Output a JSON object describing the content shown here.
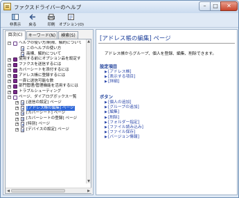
{
  "window": {
    "title": "ファクスドライバーのヘルプ",
    "minimize": "–",
    "maximize": "□",
    "close": "✕"
  },
  "toolbar": [
    {
      "icon": "hide-pane-icon",
      "label": "非表示"
    },
    {
      "icon": "back-arrow-icon",
      "label": "戻る"
    },
    {
      "icon": "printer-icon",
      "label": "印刷"
    },
    {
      "icon": "options-icon",
      "label": "オプション(O)"
    }
  ],
  "tabs": [
    "目次(C)",
    "キーワード(N)",
    "検索(S)"
  ],
  "tree": [
    {
      "level": 0,
      "type": "book-open",
      "expander": "−",
      "label": "ヘルプの使い方/制限、解約について",
      "selected": false
    },
    {
      "level": 1,
      "type": "page",
      "expander": "",
      "label": "このヘルプの使い方",
      "selected": false
    },
    {
      "level": 1,
      "type": "page",
      "expander": "",
      "label": "商標、解約について",
      "selected": false
    },
    {
      "level": 0,
      "type": "book",
      "expander": "+",
      "label": "使用する前にオプション品を設定す",
      "selected": false
    },
    {
      "level": 0,
      "type": "book",
      "expander": "+",
      "label": "ファクスを送信するには",
      "selected": false
    },
    {
      "level": 0,
      "type": "book",
      "expander": "+",
      "label": "カバーシートを添付するには",
      "selected": false
    },
    {
      "level": 0,
      "type": "book",
      "expander": "+",
      "label": "アドレス帳に登録するには",
      "selected": false
    },
    {
      "level": 0,
      "type": "book",
      "expander": "+",
      "label": "一斉に送信可能な数",
      "selected": false
    },
    {
      "level": 0,
      "type": "book",
      "expander": "+",
      "label": "部門管理/管理機能を活用するには",
      "selected": false
    },
    {
      "level": 0,
      "type": "book",
      "expander": "+",
      "label": "トラブルシューティング",
      "selected": false
    },
    {
      "level": 0,
      "type": "book-open",
      "expander": "−",
      "label": "ページ、ダイアログボックス一覧",
      "selected": false
    },
    {
      "level": 1,
      "type": "page",
      "expander": "+",
      "label": "[送信の設定] ページ",
      "selected": false
    },
    {
      "level": 1,
      "type": "page",
      "expander": "+",
      "label": "[アドレス帳の編集] ページ",
      "selected": true
    },
    {
      "level": 1,
      "type": "page",
      "expander": "+",
      "label": "[カバーシート] ページ",
      "selected": false
    },
    {
      "level": 1,
      "type": "page",
      "expander": "+",
      "label": "[カバーシートの登録] ページ",
      "selected": false
    },
    {
      "level": 1,
      "type": "page",
      "expander": "+",
      "label": "[特別] ページ",
      "selected": false
    },
    {
      "level": 1,
      "type": "page",
      "expander": "+",
      "label": "[デバイスの設定] ページ",
      "selected": false
    }
  ],
  "content": {
    "title": "[アドレス帳の編集] ページ",
    "intro": "アドレス帳からグループ、個人を登録、編集、削除できます。",
    "section1": "設定項目",
    "links1": [
      "[アドレス帳]",
      "[表示する項目]",
      "[詳細]"
    ],
    "section2": "ボタン",
    "links2": [
      "[個人の追加]",
      "[グループの追加]",
      "[編集]",
      "[削除]",
      "[フォルダー指定]",
      "[ファイル読み込み]",
      "[ファイル保存]",
      "[バージョン情報]"
    ]
  },
  "colors": {
    "selection": "#3068d8",
    "link": "#2844a8",
    "heading": "#1d3f9a",
    "book": "#7a2a8a"
  }
}
